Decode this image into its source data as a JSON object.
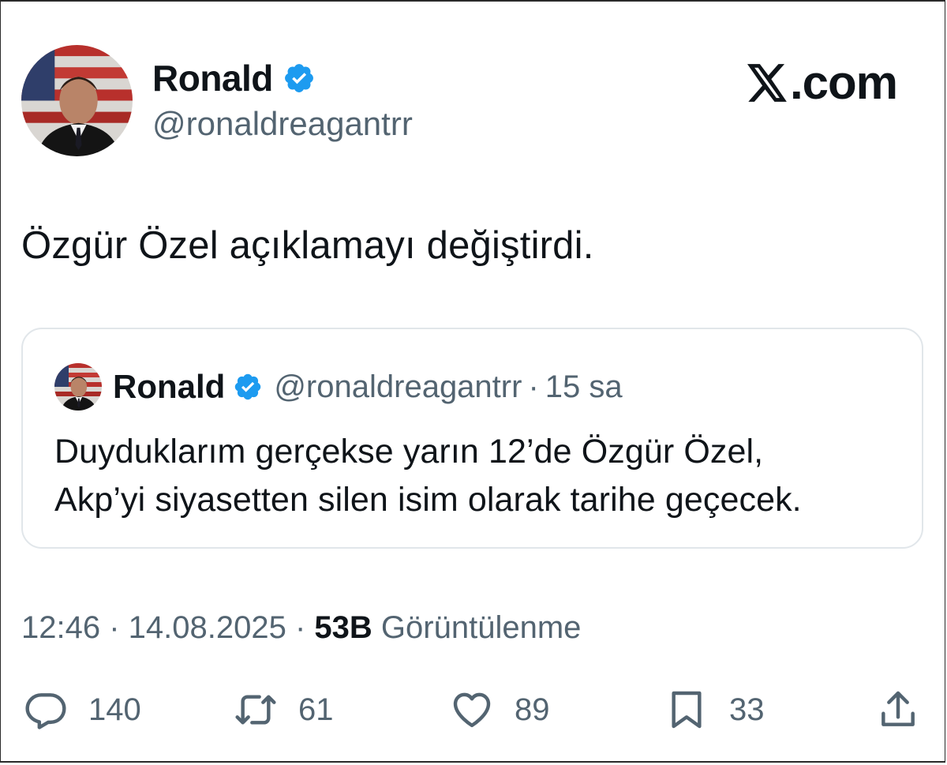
{
  "author": {
    "name": "Ronald",
    "handle": "@ronaldreagantrr"
  },
  "brand": {
    "domain": ".com"
  },
  "tweet": {
    "text": "Özgür Özel açıklamayı değiştirdi."
  },
  "quoted": {
    "name": "Ronald",
    "handle": "@ronaldreagantrr",
    "separator": "·",
    "time": "15 sa",
    "line1": "Duyduklarım gerçekse yarın 12’de Özgür Özel,",
    "line2": "Akp’yi siyasetten silen isim olarak tarihe geçecek."
  },
  "meta": {
    "time": "12:46",
    "date": "14.08.2025",
    "separator": " · ",
    "views_count": "53B",
    "views_label": "Görüntülenme"
  },
  "actions": {
    "reply_count": "140",
    "retweet_count": "61",
    "like_count": "89",
    "bookmark_count": "33"
  },
  "icons": {
    "verified": "verified-badge-icon",
    "reply": "reply-icon",
    "retweet": "retweet-icon",
    "like": "heart-icon",
    "bookmark": "bookmark-icon",
    "share": "share-icon",
    "logo": "x-logo-icon"
  },
  "colors": {
    "verified": "#1d9bf0",
    "text": "#0f1419",
    "secondary": "#536471"
  }
}
